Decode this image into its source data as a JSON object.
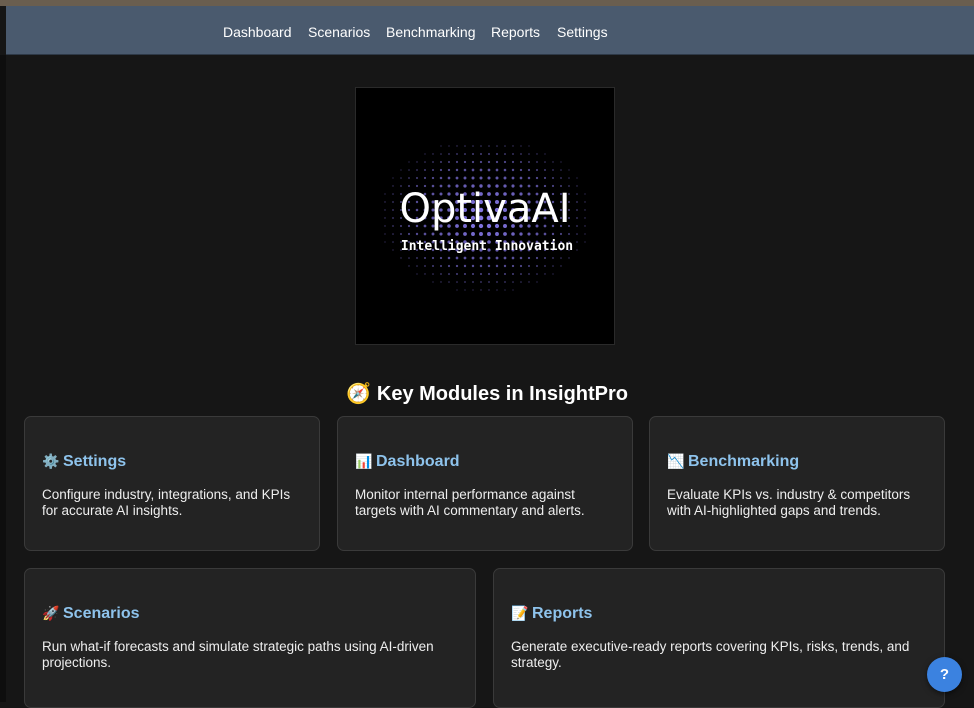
{
  "nav": {
    "items": [
      "Dashboard",
      "Scenarios",
      "Benchmarking",
      "Reports",
      "Settings"
    ]
  },
  "logo": {
    "brand": "OptivaAI",
    "tagline": "Intelligent Innovation"
  },
  "section": {
    "icon": "compass-icon",
    "title": "Key Modules in InsightPro"
  },
  "modules": [
    {
      "icon": "gear-icon",
      "glyph": "⚙️",
      "title": "Settings",
      "description_lines": [
        "Configure industry, integrations, and KPIs",
        "for accurate AI insights."
      ]
    },
    {
      "icon": "bar-chart-icon",
      "glyph": "📊",
      "title": "Dashboard",
      "description_lines": [
        "Monitor internal performance against",
        "targets with AI commentary and alerts."
      ]
    },
    {
      "icon": "chart-down-icon",
      "glyph": "📉",
      "title": "Benchmarking",
      "description_lines": [
        "Evaluate KPIs vs. industry & competitors",
        "with AI-highlighted gaps and trends."
      ]
    },
    {
      "icon": "rocket-icon",
      "glyph": "🚀",
      "title": "Scenarios",
      "description_lines": [
        "Run what-if forecasts and simulate strategic paths using AI-driven",
        "projections."
      ]
    },
    {
      "icon": "memo-icon",
      "glyph": "📝",
      "title": "Reports",
      "description_lines": [
        "Generate executive-ready reports covering KPIs, risks, trends, and",
        "strategy."
      ]
    }
  ],
  "help": {
    "label": "?"
  },
  "colors": {
    "navbar": "#4a5a6e",
    "background": "#161616",
    "card": "#232323",
    "card_title": "#8ec3ec",
    "help_button": "#3b82e0",
    "logo_dots": "#8a7cf0"
  }
}
